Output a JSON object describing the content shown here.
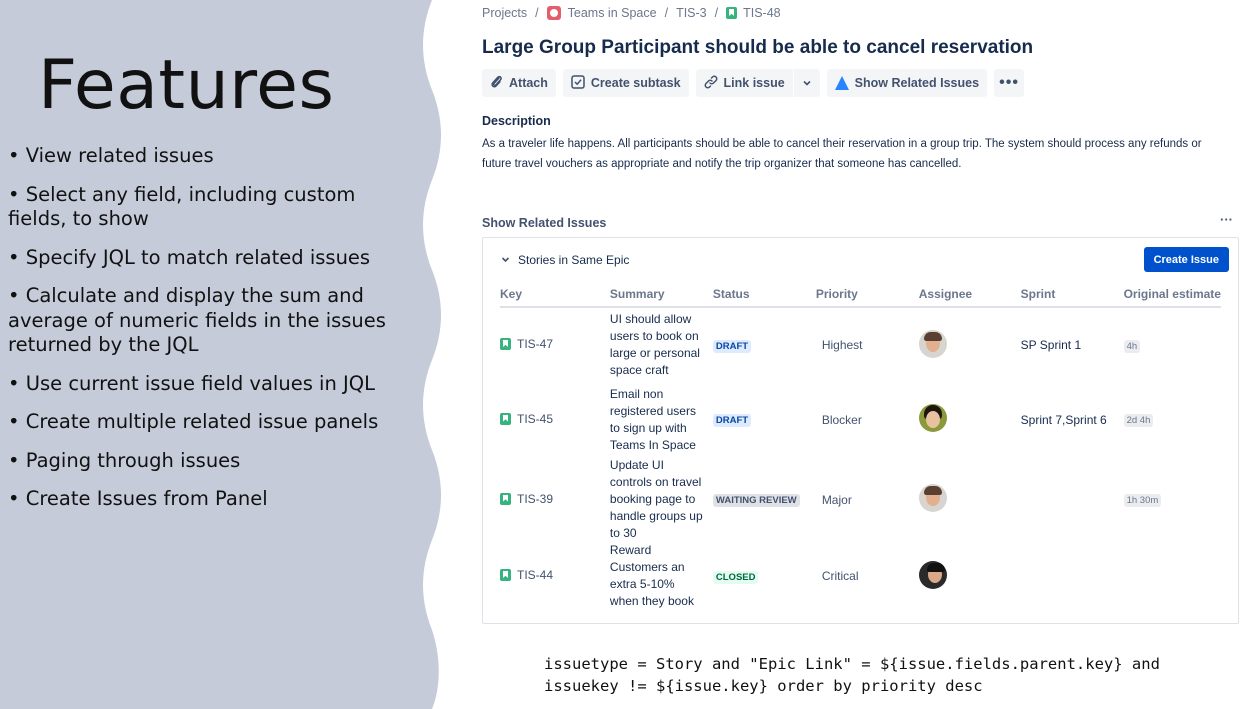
{
  "slide": {
    "title": "Features",
    "features": [
      "• View related issues",
      "• Select any field, including custom fields, to show",
      "• Specify JQL to match related issues",
      "• Calculate and display the sum and average of numeric fields in the issues returned by the JQL",
      "• Use current issue field values in JQL",
      "• Create multiple related issue panels",
      "• Paging through issues",
      "• Create Issues from Panel"
    ],
    "panel_color": "#c5cbd9"
  },
  "breadcrumb": {
    "projects": "Projects",
    "project": "Teams in Space",
    "epic": "TIS-3",
    "issue": "TIS-48"
  },
  "issue": {
    "title": "Large Group Participant should be able to cancel reservation",
    "description_label": "Description",
    "description": "As a traveler life happens. All participants should be able to cancel their reservation in a group trip. The system should process any refunds or future travel vouchers as appropriate and notify the trip organizer that someone has cancelled."
  },
  "toolbar": {
    "attach": "Attach",
    "create_subtask": "Create subtask",
    "link_issue": "Link issue",
    "show_related": "Show Related Issues",
    "more": "•••"
  },
  "related_panel": {
    "header": "Show Related Issues",
    "more": "···",
    "group_label": "Stories in Same Epic",
    "create_button": "Create Issue",
    "columns": [
      "Key",
      "Summary",
      "Status",
      "Priority",
      "Assignee",
      "Sprint",
      "Original estimate"
    ],
    "rows": [
      {
        "key": "TIS-47",
        "summary": "UI should allow users to book on large or personal space craft",
        "status": "DRAFT",
        "priority": "Highest",
        "sprint": "SP Sprint 1",
        "estimate": "4h"
      },
      {
        "key": "TIS-45",
        "summary": "Email non registered users to sign up with Teams In Space",
        "status": "DRAFT",
        "priority": "Blocker",
        "sprint": "Sprint 7,Sprint 6",
        "estimate": "2d 4h"
      },
      {
        "key": "TIS-39",
        "summary": "Update UI controls on travel booking page to handle groups up to 30",
        "status": "WAITING REVIEW",
        "priority": "Major",
        "sprint": "",
        "estimate": "1h 30m"
      },
      {
        "key": "TIS-44",
        "summary": "Reward Customers an extra 5-10% when they book",
        "status": "CLOSED",
        "priority": "Critical",
        "sprint": "",
        "estimate": ""
      }
    ]
  },
  "jql": {
    "line1": "issuetype = Story and \"Epic Link\" = ${issue.fields.parent.key} and",
    "line2": "issuekey != ${issue.key} order by priority desc"
  }
}
